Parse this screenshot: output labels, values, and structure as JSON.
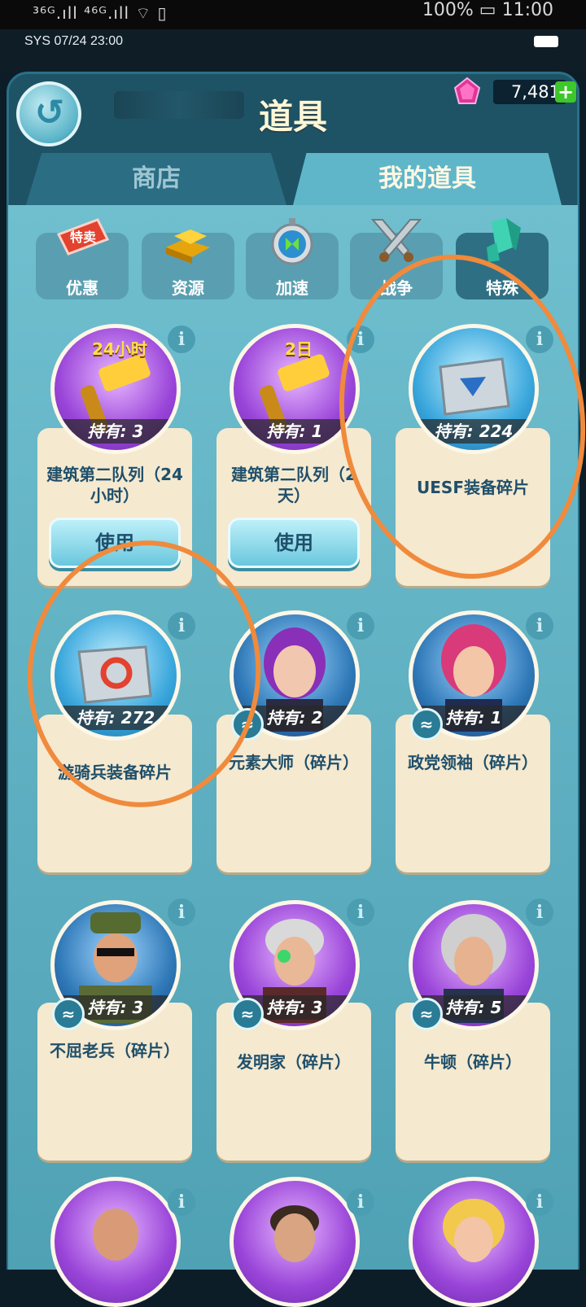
{
  "status_bar": {
    "left": "³⁶ᴳ.ıll ⁴⁶ᴳ.ıll ⌔ ▯",
    "right": "100% ▭ 11:00"
  },
  "sys_bar": {
    "text": "SYS 07/24 23:00"
  },
  "header": {
    "title": "道具",
    "gem_count": "7,481",
    "plus": "+"
  },
  "tabs": [
    {
      "label": "商店"
    },
    {
      "label": "我的道具"
    }
  ],
  "categories": [
    {
      "label": "优惠",
      "icon": "sale-tag-icon"
    },
    {
      "label": "资源",
      "icon": "gold-bars-icon"
    },
    {
      "label": "加速",
      "icon": "stopwatch-icon"
    },
    {
      "label": "战争",
      "icon": "crossed-swords-icon"
    },
    {
      "label": "特殊",
      "icon": "crystal-icon"
    }
  ],
  "items": [
    {
      "badge": "24小时",
      "hold": "持有: 3",
      "name": "建筑第二队列（24小时）",
      "button": "使用"
    },
    {
      "badge": "2日",
      "hold": "持有: 1",
      "name": "建筑第二队列（2天）",
      "button": "使用"
    },
    {
      "hold": "持有: 224",
      "name": "UESF装备碎片"
    },
    {
      "hold": "持有: 272",
      "name": "游骑兵装备碎片"
    },
    {
      "hold": "持有: 2",
      "name": "元素大师（碎片）"
    },
    {
      "hold": "持有: 1",
      "name": "政党领袖（碎片）"
    },
    {
      "hold": "持有: 3",
      "name": "不屈老兵（碎片）"
    },
    {
      "hold": "持有: 3",
      "name": "发明家（碎片）"
    },
    {
      "hold": "持有: 5",
      "name": "牛顿（碎片）"
    }
  ],
  "colors": {
    "accent_orange": "#f08a3c",
    "panel": "#6ab7c6",
    "card": "#f5e9cf"
  }
}
